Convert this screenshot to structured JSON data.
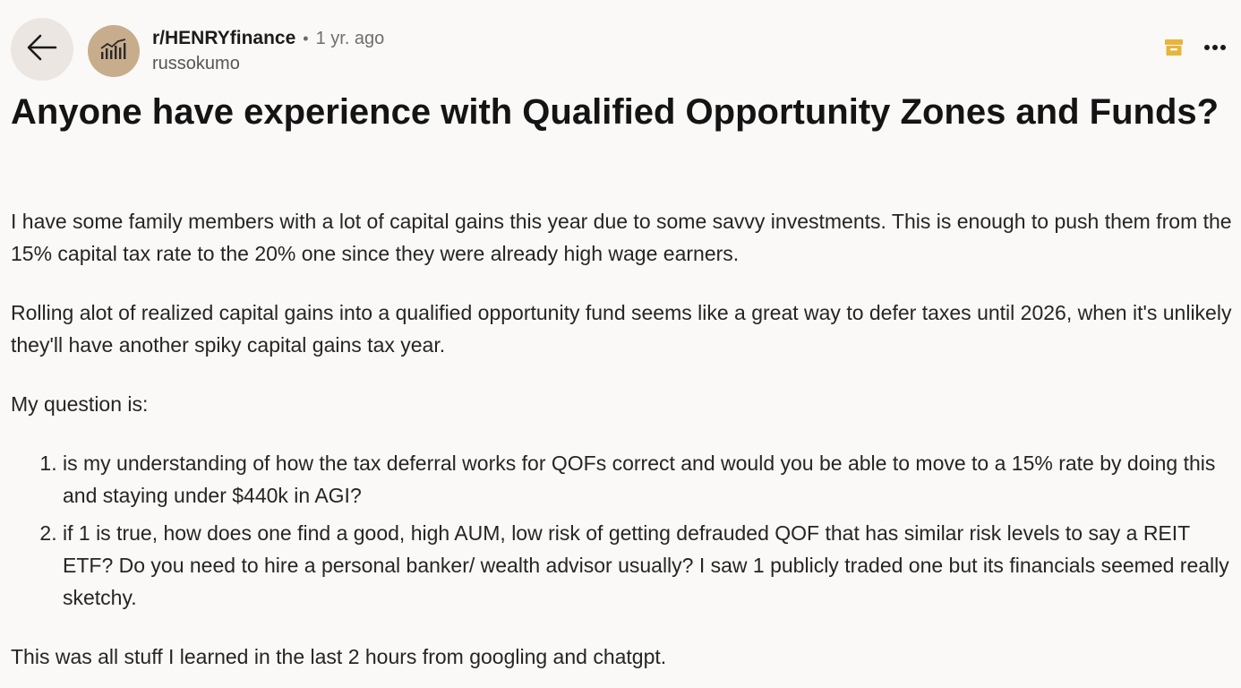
{
  "header": {
    "subreddit": "r/HENRYfinance",
    "separator": "•",
    "time": "1 yr. ago",
    "username": "russokumo",
    "icons": {
      "back": "arrow-left-icon",
      "avatar": "bar-chart-icon",
      "archive": "archive-icon",
      "more": "more-horizontal-icon"
    },
    "colors": {
      "archive": "#e6b53a",
      "avatar_bg": "#c7ad8c"
    }
  },
  "post": {
    "title": "Anyone have experience with Qualified Opportunity Zones and Funds?",
    "paragraphs": [
      "I have some family members with a lot of capital gains this year due to some savvy investments. This is enough to push them from the 15% capital tax rate to the 20% one since they were already high wage earners.",
      "Rolling alot of realized capital gains into a qualified opportunity fund seems like a great way to defer taxes until 2026, when it's unlikely they'll have another spiky capital gains tax year.",
      "My question is:"
    ],
    "list": [
      "is my understanding of how the tax deferral works for QOFs correct and would you be able to move to a 15% rate by doing this and staying under $440k in AGI?",
      "if 1 is true, how does one find a good, high AUM, low risk of getting defrauded QOF that has similar risk levels to say a REIT ETF? Do you need to hire a personal banker/ wealth advisor usually? I saw 1 publicly traded one but its financials seemed really sketchy."
    ],
    "closing": "This was all stuff I learned in the last 2 hours from googling and chatgpt."
  }
}
